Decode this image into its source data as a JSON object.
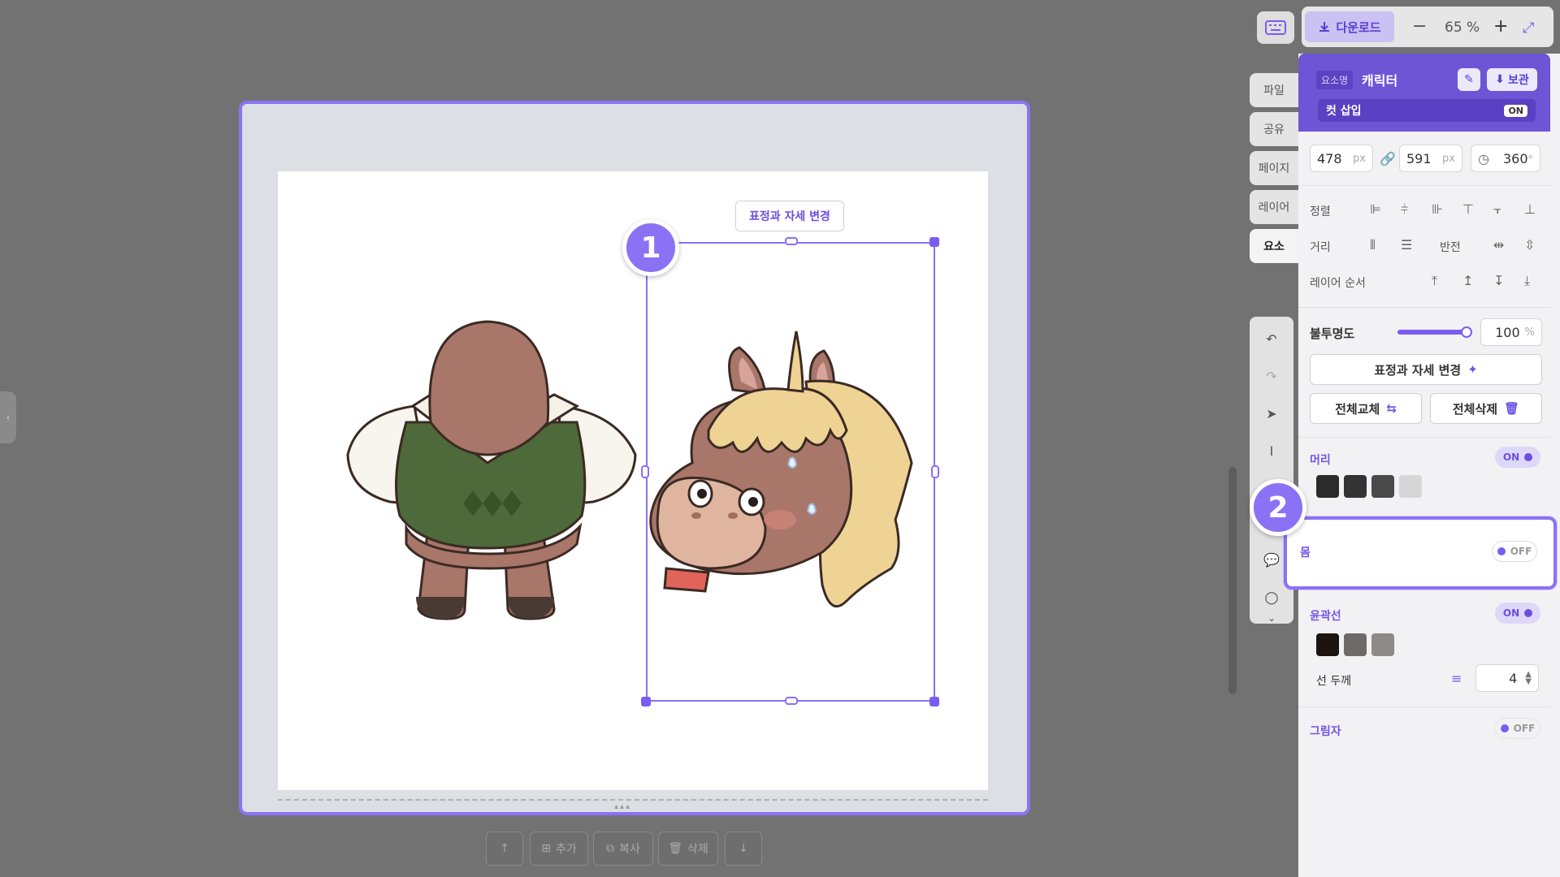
{
  "toolbar": {
    "download_label": "다운로드",
    "zoom_minus": "−",
    "zoom_value": "65",
    "zoom_unit": "%",
    "zoom_plus": "+"
  },
  "side_tabs": [
    "파일",
    "공유",
    "페이지",
    "레이어",
    "요소"
  ],
  "canvas": {
    "pose_button_label": "표정과 자세 변경",
    "badge_1": "1",
    "badge_2": "2"
  },
  "bottom_toolbar": {
    "add_label": "추가",
    "copy_label": "복사",
    "delete_label": "삭제"
  },
  "panel": {
    "element_name_tag": "요소명",
    "element_name": "캐릭터",
    "store_label": "보관",
    "cut_insert_label": "컷 삽입",
    "cut_insert_state": "ON",
    "width": "478",
    "width_unit": "px",
    "height": "591",
    "height_unit": "px",
    "rotation": "360",
    "rotation_unit": "°",
    "align_label": "정렬",
    "distance_label": "거리",
    "flip_label": "반전",
    "layer_order_label": "레이어 순서",
    "opacity_label": "불투명도",
    "opacity_value": "100",
    "opacity_unit": "%",
    "opacity_fraction": 1.0,
    "change_pose_label": "표정과 자세 변경",
    "replace_all_label": "전체교체",
    "delete_all_label": "전체삭제",
    "head_label": "머리",
    "head_state": "ON",
    "head_colors": [
      "#2b2b2b",
      "#333333",
      "#4a4a4a",
      "#d6d6d6"
    ],
    "body_label": "몸",
    "body_state": "OFF",
    "outline_label": "윤곽선",
    "outline_state": "ON",
    "outline_colors": [
      "#1c1410",
      "#6e6a68",
      "#8d8a88"
    ],
    "line_width_label": "선 두께",
    "line_width_value": "4",
    "shadow_label": "그림자",
    "shadow_state": "OFF"
  },
  "colors": {
    "accent": "#8b72f5",
    "panel_header": "#6e55d6"
  }
}
